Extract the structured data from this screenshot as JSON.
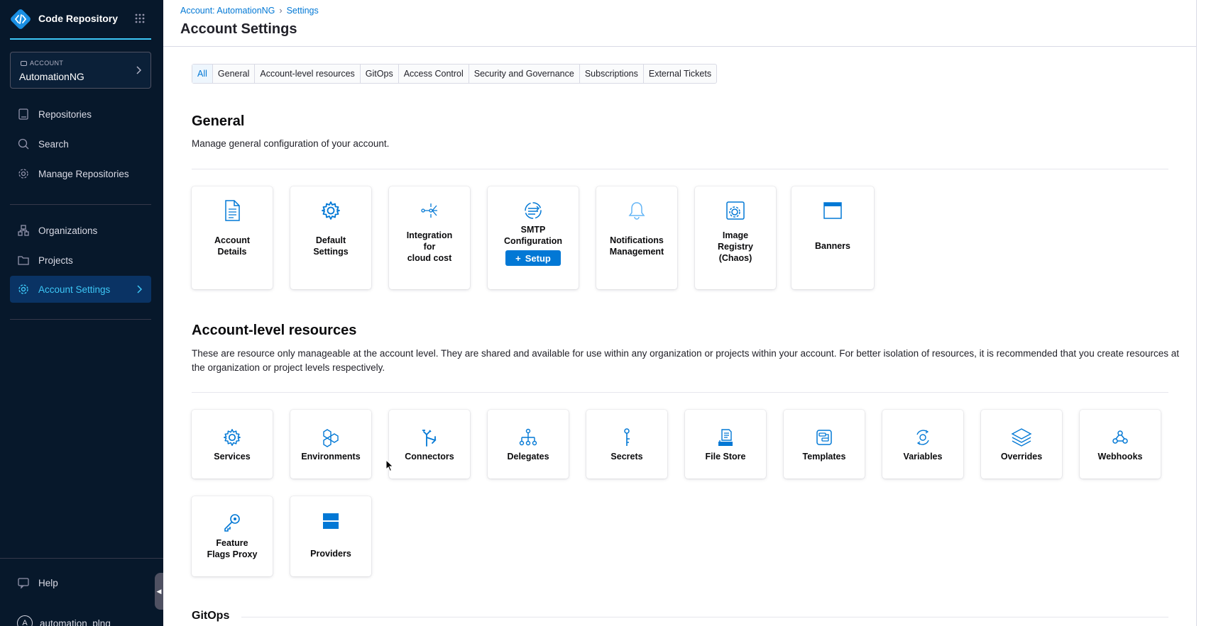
{
  "app": {
    "name": "Code Repository",
    "account_label": "ACCOUNT",
    "account_name": "AutomationNG"
  },
  "sidebar": {
    "items": [
      {
        "label": "Repositories",
        "icon": "repository-icon"
      },
      {
        "label": "Search",
        "icon": "search-icon"
      },
      {
        "label": "Manage Repositories",
        "icon": "gear-icon"
      },
      {
        "label": "Organizations",
        "icon": "organizations-icon"
      },
      {
        "label": "Projects",
        "icon": "projects-icon"
      },
      {
        "label": "Account Settings",
        "icon": "gear-icon"
      }
    ],
    "help": "Help",
    "user": {
      "initial": "A",
      "name": "automation_plng"
    }
  },
  "header": {
    "breadcrumb": [
      "Account: AutomationNG",
      "Settings"
    ],
    "title": "Account Settings"
  },
  "tabs": [
    "All",
    "General",
    "Account-level resources",
    "GitOps",
    "Access Control",
    "Security and Governance",
    "Subscriptions",
    "External Tickets"
  ],
  "general": {
    "title": "General",
    "description": "Manage general configuration of your account.",
    "cards": [
      {
        "label": "Account Details",
        "lines": [
          "Account",
          "Details"
        ],
        "icon": "document-icon"
      },
      {
        "label": "Default Settings",
        "lines": [
          "Default",
          "Settings"
        ],
        "icon": "gear-icon"
      },
      {
        "label": "Integration for cloud cost",
        "lines": [
          "Integration",
          "for",
          "cloud cost"
        ],
        "icon": "integration-icon"
      },
      {
        "label": "SMTP Configuration",
        "lines": [
          "SMTP",
          "Configuration"
        ],
        "icon": "smtp-icon",
        "button": "Setup"
      },
      {
        "label": "Notifications Management",
        "lines": [
          "Notifications",
          "Management"
        ],
        "icon": "bell-icon"
      },
      {
        "label": "Image Registry (Chaos)",
        "lines": [
          "Image",
          "Registry",
          "(Chaos)"
        ],
        "icon": "image-registry-icon"
      },
      {
        "label": "Banners",
        "lines": [
          "Banners"
        ],
        "icon": "banner-icon"
      }
    ]
  },
  "resources": {
    "title": "Account-level resources",
    "description": "These are resource only manageable at the account level. They are shared and available for use within any organization or projects within your account. For better isolation of resources, it is recommended that you create resources at the organization or project levels respectively.",
    "cards": [
      {
        "label": "Services",
        "lines": [
          "Services"
        ],
        "icon": "services-icon"
      },
      {
        "label": "Environments",
        "lines": [
          "Environments"
        ],
        "icon": "environments-icon"
      },
      {
        "label": "Connectors",
        "lines": [
          "Connectors"
        ],
        "icon": "connectors-icon"
      },
      {
        "label": "Delegates",
        "lines": [
          "Delegates"
        ],
        "icon": "delegates-icon"
      },
      {
        "label": "Secrets",
        "lines": [
          "Secrets"
        ],
        "icon": "secrets-icon"
      },
      {
        "label": "File Store",
        "lines": [
          "File Store"
        ],
        "icon": "file-store-icon"
      },
      {
        "label": "Templates",
        "lines": [
          "Templates"
        ],
        "icon": "templates-icon"
      },
      {
        "label": "Variables",
        "lines": [
          "Variables"
        ],
        "icon": "variables-icon"
      },
      {
        "label": "Overrides",
        "lines": [
          "Overrides"
        ],
        "icon": "overrides-icon"
      },
      {
        "label": "Webhooks",
        "lines": [
          "Webhooks"
        ],
        "icon": "webhooks-icon"
      },
      {
        "label": "Feature Flags Proxy",
        "lines": [
          "Feature",
          "Flags Proxy"
        ],
        "icon": "key-icon"
      },
      {
        "label": "Providers",
        "lines": [
          "Providers"
        ],
        "icon": "providers-icon"
      }
    ]
  },
  "gitops": {
    "title": "GitOps"
  },
  "colors": {
    "accent": "#0278d5",
    "sidebar_bg": "#07182b",
    "sidebar_active": "#0a3364",
    "sidebar_highlight": "#3dc7f6"
  }
}
